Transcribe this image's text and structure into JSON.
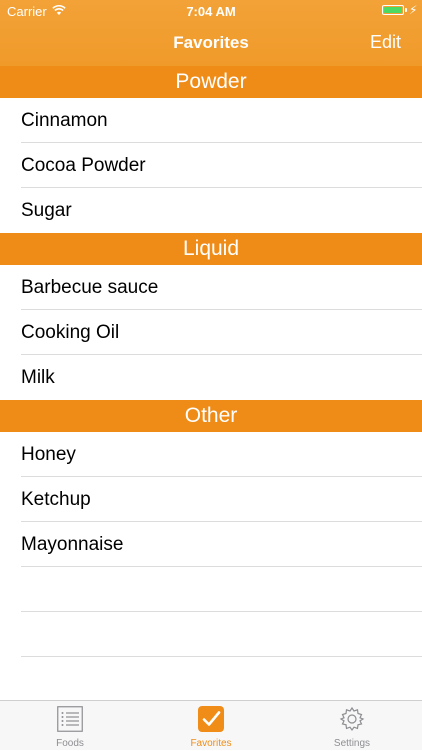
{
  "status_bar": {
    "carrier": "Carrier",
    "time": "7:04 AM"
  },
  "nav": {
    "title": "Favorites",
    "edit_label": "Edit"
  },
  "sections": [
    {
      "title": "Powder",
      "items": [
        "Cinnamon",
        "Cocoa Powder",
        "Sugar"
      ]
    },
    {
      "title": "Liquid",
      "items": [
        "Barbecue sauce",
        "Cooking Oil",
        "Milk"
      ]
    },
    {
      "title": "Other",
      "items": [
        "Honey",
        "Ketchup",
        "Mayonnaise"
      ]
    }
  ],
  "tabs": [
    {
      "label": "Foods",
      "icon": "list-icon",
      "active": false
    },
    {
      "label": "Favorites",
      "icon": "checkmark-icon",
      "active": true
    },
    {
      "label": "Settings",
      "icon": "gear-icon",
      "active": false
    }
  ],
  "colors": {
    "accent": "#ef8b17",
    "battery": "#4cd964"
  }
}
